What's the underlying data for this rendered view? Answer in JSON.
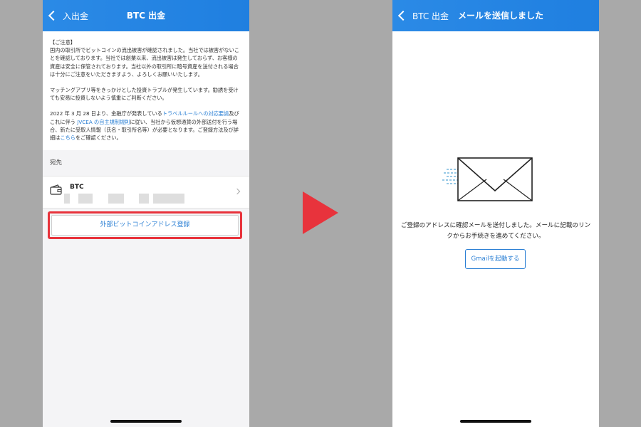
{
  "left_screen": {
    "nav": {
      "back_label": "入出金",
      "title": "BTC 出金"
    },
    "notice": {
      "heading": "【ご注意】",
      "paragraph1": "国内の取引所でビットコインの流出被害が確認されました。当社では被害がないことを確認しております。当社では創業以来、流出被害は発生しておらず、お客様の資産は安全に保管されております。当社以外の取引所に暗号資産を送付される場合は十分にご注意をいただきますよう、よろしくお願いいたします。",
      "paragraph2": "マッチングアプリ等をきっかけとした投資トラブルが発生しています。勧誘を受けても安易に投資しないよう慎重にご判断ください。",
      "p3_a": "2022 年 3 月 28 日より、金融庁が発表している",
      "p3_link1": "トラベルルールへの対応要請",
      "p3_b": "及びこれに伴う ",
      "p3_link2": "JVCEA の自主規制規則",
      "p3_c": "に従い、当社から仮想通貨の外部送付を行う場合、新たに受取人情報（氏名・取引所名等）が必要となります。ご登録方法及び詳細は",
      "p3_link3": "こちら",
      "p3_d": "をご確認ください。"
    },
    "section_label": "宛先",
    "destination": {
      "currency": "BTC"
    },
    "register_button_label": "外部ビットコインアドレス登録"
  },
  "right_screen": {
    "nav": {
      "back_label": "BTC 出金",
      "title": "メールを送信しました"
    },
    "message": "ご登録のアドレスに確認メールを送付しました。メールに記載のリンクからお手続きを進めてください。",
    "gmail_button_label": "Gmailを起動する"
  },
  "colors": {
    "nav_blue": "#1f7fe0",
    "link_blue": "#2a7fd4",
    "highlight_red": "#e8333c",
    "background_gray": "#a9a9a9"
  },
  "icons": {
    "back": "chevron-left-icon",
    "wallet": "wallet-icon",
    "row_chevron": "chevron-right-icon",
    "transition_arrow": "play-arrow-icon",
    "envelope": "envelope-icon"
  }
}
